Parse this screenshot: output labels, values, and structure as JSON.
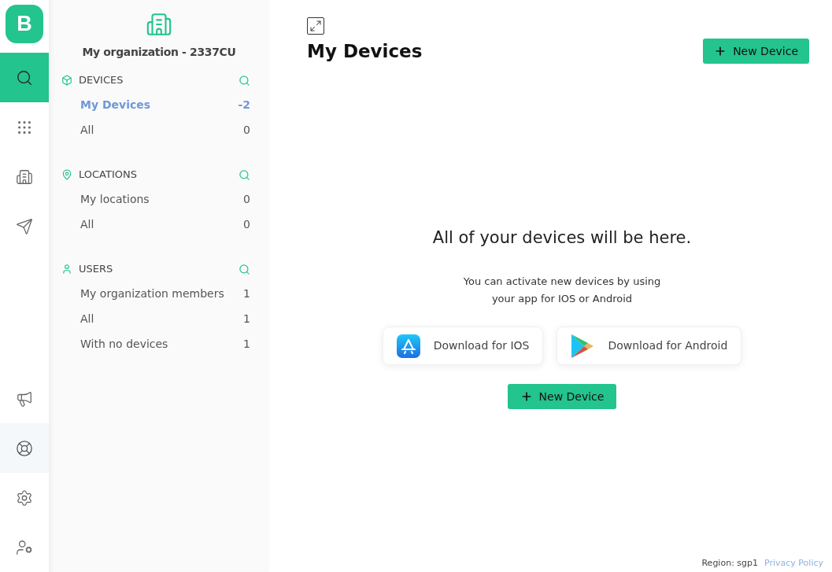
{
  "logo": {
    "letter": "B"
  },
  "rail": {
    "top": [
      {
        "kind": "search",
        "selected": true,
        "hovered": false
      },
      {
        "kind": "grid",
        "selected": false,
        "hovered": false
      },
      {
        "kind": "building",
        "selected": false,
        "hovered": false
      },
      {
        "kind": "send",
        "selected": false,
        "hovered": false
      }
    ],
    "bottom": [
      {
        "kind": "megaphone",
        "selected": false,
        "hovered": false
      },
      {
        "kind": "lifebuoy",
        "selected": false,
        "hovered": true
      },
      {
        "kind": "settings",
        "selected": false,
        "hovered": false
      },
      {
        "kind": "user",
        "selected": false,
        "hovered": false
      }
    ]
  },
  "sidebar": {
    "organization": "My organization - 2337CU",
    "sections": [
      {
        "kind": "devices",
        "title": "DEVICES",
        "items": [
          {
            "label": "My Devices",
            "count": "-2",
            "selected": true
          },
          {
            "label": "All",
            "count": "0",
            "selected": false
          }
        ]
      },
      {
        "kind": "locations",
        "title": "LOCATIONS",
        "items": [
          {
            "label": "My locations",
            "count": "0",
            "selected": false
          },
          {
            "label": "All",
            "count": "0",
            "selected": false
          }
        ]
      },
      {
        "kind": "users",
        "title": "USERS",
        "items": [
          {
            "label": "My organization members",
            "count": "1",
            "selected": false
          },
          {
            "label": "All",
            "count": "1",
            "selected": false
          },
          {
            "label": "With no devices",
            "count": "1",
            "selected": false
          }
        ]
      }
    ]
  },
  "main": {
    "title": "My Devices",
    "new_device_button": "New Device",
    "empty_state": {
      "heading": "All of your devices will be here.",
      "text_lines": [
        "You can activate new devices by using",
        "your app for IOS or Android"
      ],
      "downloads": [
        {
          "kind": "ios",
          "label": "Download for IOS"
        },
        {
          "kind": "android",
          "label": "Download for Android"
        }
      ],
      "button": "New Device"
    }
  },
  "footer": {
    "region": "Region: sgp1",
    "privacy_link": "Privacy Policy"
  }
}
